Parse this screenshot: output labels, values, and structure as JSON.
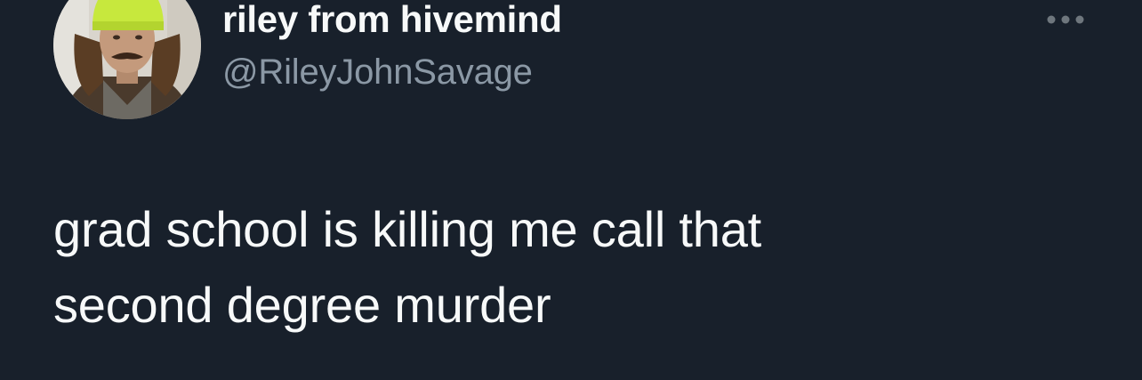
{
  "tweet": {
    "author": {
      "display_name": "riley from hivemind",
      "handle": "@RileyJohnSavage",
      "avatar_icon": "profile-photo"
    },
    "more_icon": "more-horizontal-icon",
    "text_lines": [
      "grad school is killing me call that",
      "second degree murder"
    ]
  },
  "colors": {
    "background": "#18202b",
    "primary_text": "#f7f9f9",
    "secondary_text": "#8b98a5"
  }
}
